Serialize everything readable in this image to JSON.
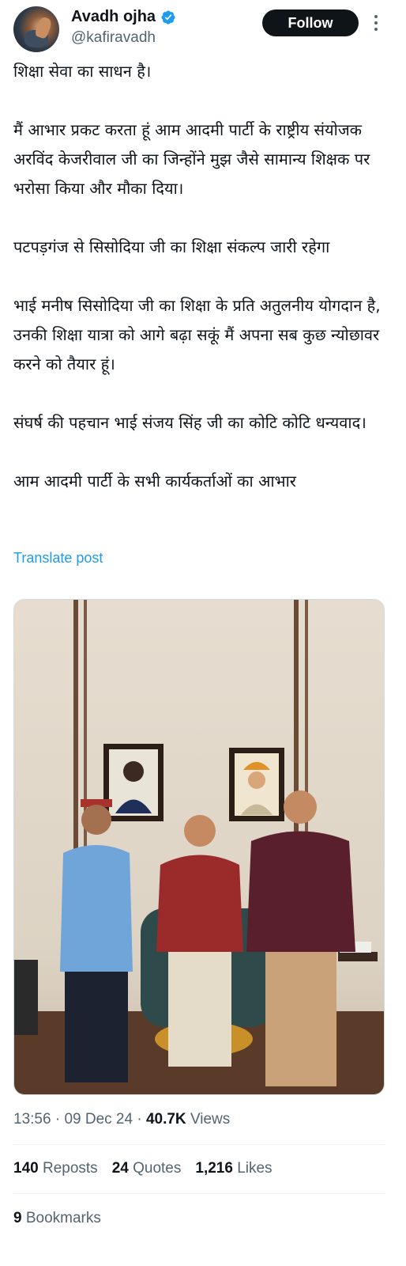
{
  "author": {
    "display_name": "Avadh ojha",
    "handle": "@kafiravadh",
    "verified": true,
    "avatar_icon": "profile-photo"
  },
  "header": {
    "follow_label": "Follow",
    "more_icon": "more-vertical-icon"
  },
  "post": {
    "paragraphs": [
      "शिक्षा सेवा का साधन है।",
      "मैं आभार प्रकट करता हूं आम आदमी पार्टी के राष्ट्रीय संयोजक अरविंद केजरीवाल जी का जिन्होंने मुझ जैसे सामान्य शिक्षक पर भरोसा किया और मौका दिया।",
      "पटपड़गंज से सिसोदिया जी का शिक्षा संकल्प जारी रहेगा",
      "भाई मनीष सिसोदिया जी का शिक्षा के प्रति अतुलनीय योगदान है, उनकी शिक्षा यात्रा को आगे बढ़ा सकूं मैं अपना सब कुछ न्योछावर करने को तैयार हूं।",
      "संघर्ष की पहचान भाई संजय सिंह जी का कोटि कोटि धन्यवाद।",
      "आम आदमी पार्टी के सभी कार्यकर्ताओं का आभार"
    ],
    "translate_label": "Translate post"
  },
  "meta": {
    "time": "13:56",
    "date": "09 Dec 24",
    "separator": "·",
    "views_count": "40.7K",
    "views_label": "Views"
  },
  "stats": {
    "reposts_count": "140",
    "reposts_label": "Reposts",
    "quotes_count": "24",
    "quotes_label": "Quotes",
    "likes_count": "1,216",
    "likes_label": "Likes",
    "bookmarks_count": "9",
    "bookmarks_label": "Bookmarks"
  },
  "colors": {
    "text": "#0f1419",
    "secondary": "#536471",
    "link": "#1d9bf0",
    "verified": "#1d9bf0",
    "button_bg": "#0f1419"
  }
}
